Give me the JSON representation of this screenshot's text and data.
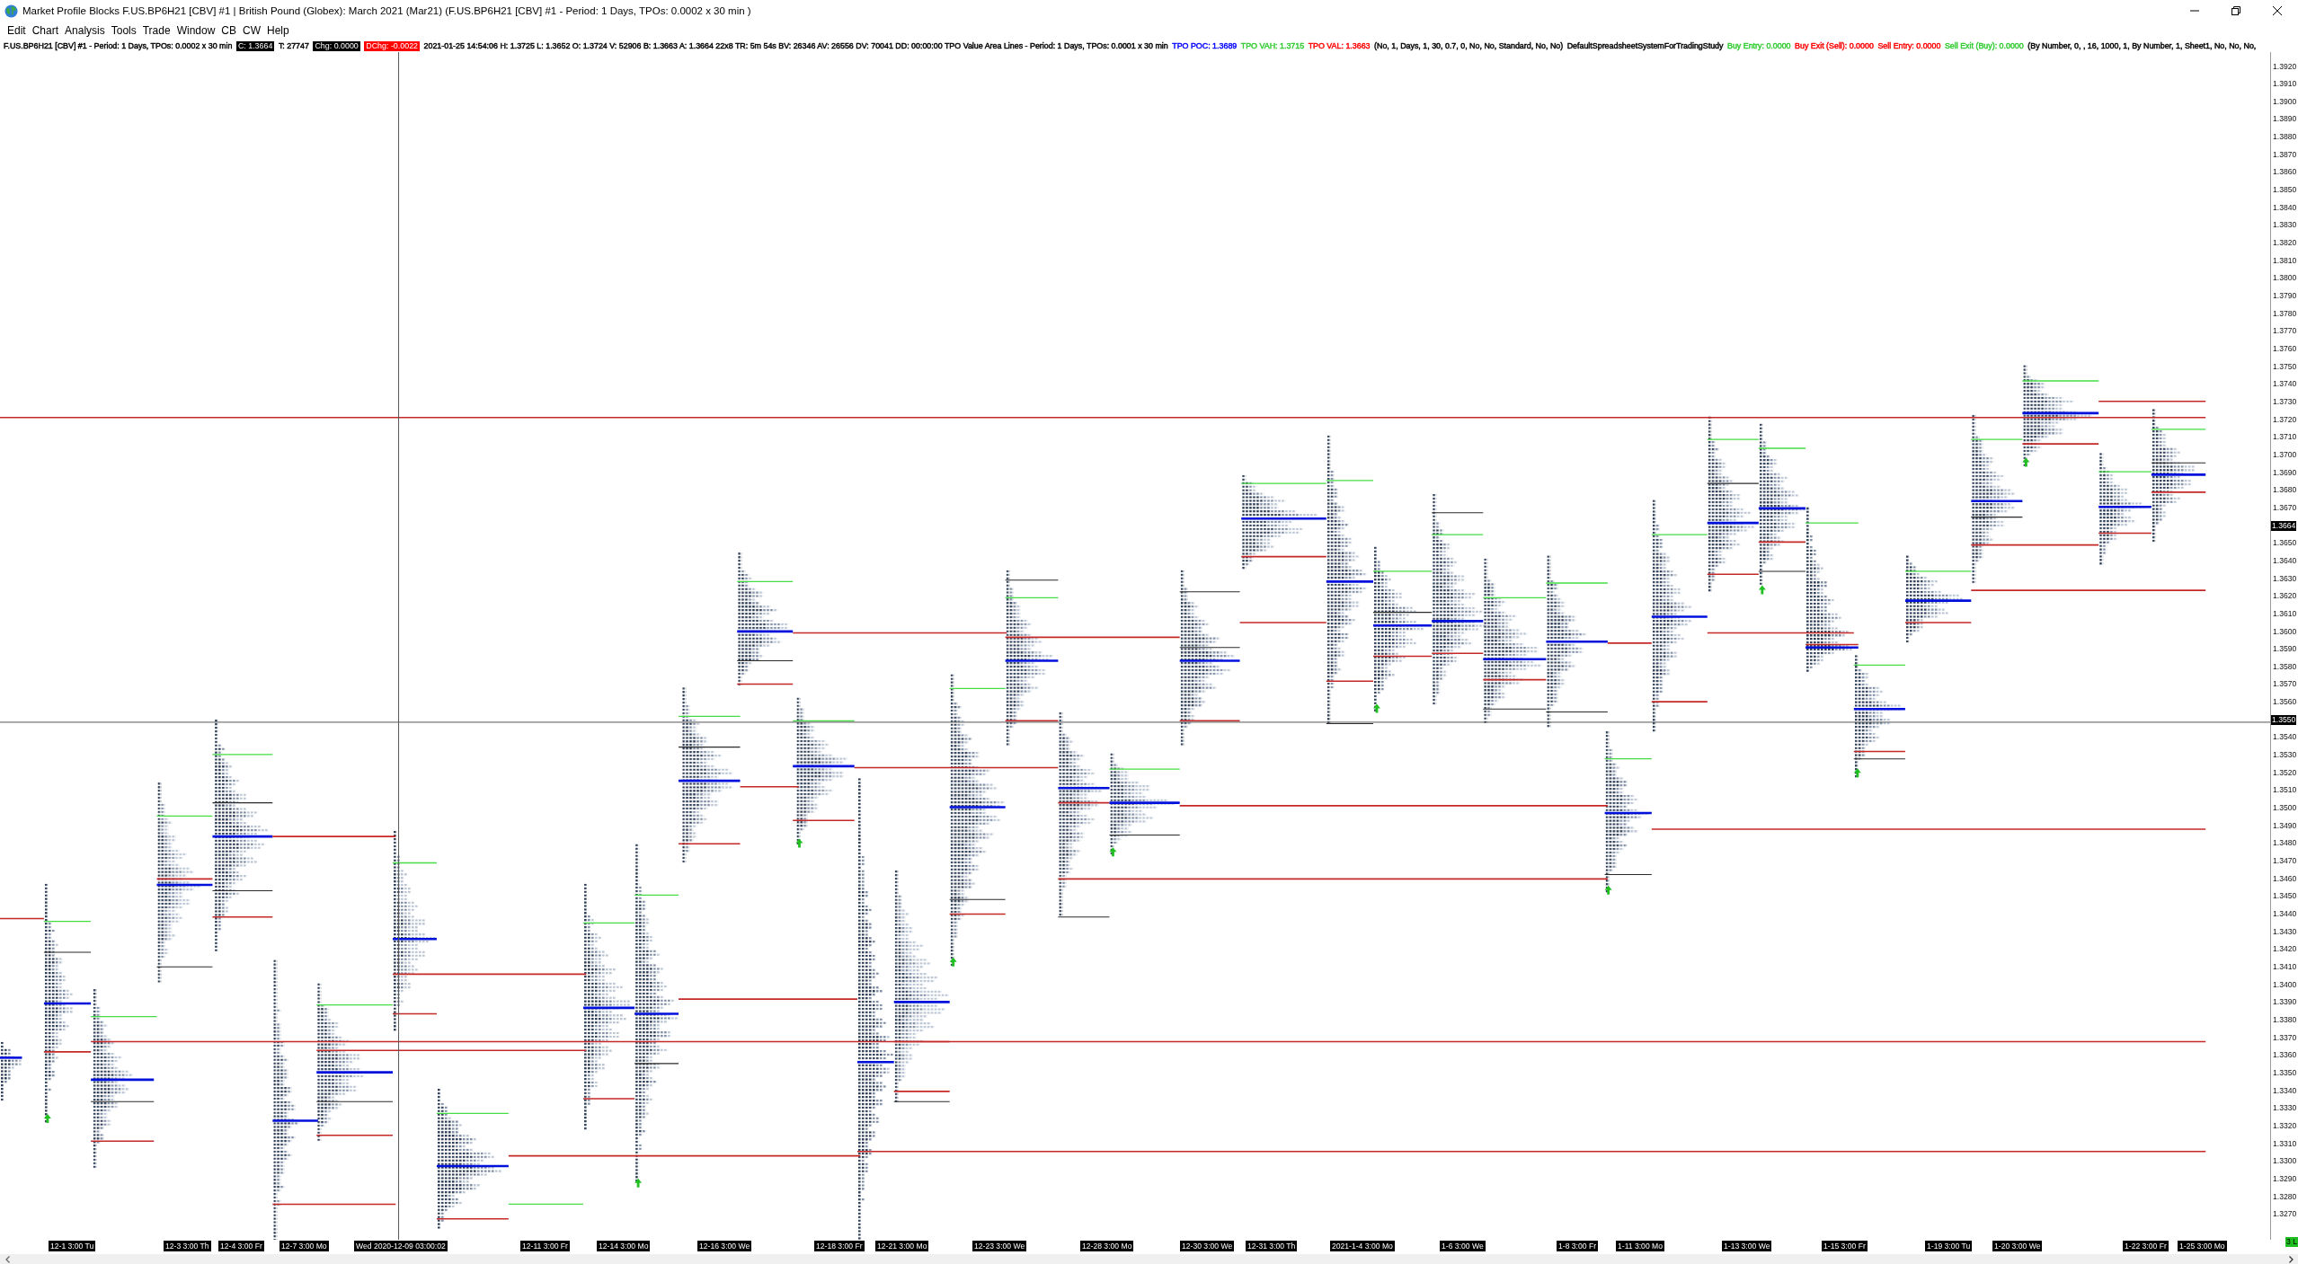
{
  "window": {
    "title": "Market Profile Blocks F.US.BP6H21 [CBV] #1 | British Pound (Globex): March 2021 (Mar21) (F.US.BP6H21 [CBV] #1 - Period: 1 Days, TPOs: 0.0002 x 30 min )"
  },
  "menu": [
    "Edit",
    "Chart",
    "Analysis",
    "Tools",
    "Trade",
    "Window",
    "CB",
    "CW",
    "Help"
  ],
  "info_line": [
    {
      "kind": "text",
      "text": "F.US.BP6H21 [CBV] #1 - Period: 1 Days, TPOs: 0.0002 x 30 min"
    },
    {
      "kind": "box",
      "text": "C: 1.3664",
      "color": "#000000"
    },
    {
      "kind": "text",
      "text": "T: 27747"
    },
    {
      "kind": "box",
      "text": "Chg: 0.0000",
      "color": "#000000"
    },
    {
      "kind": "box",
      "text": "DChg: -0.0022",
      "color": "#ff0000"
    },
    {
      "kind": "text",
      "text": "2021-01-25 14:54:06 H: 1.3725 L: 1.3652 O: 1.3724 V: 52906 B: 1.3663 A: 1.3664 22x8 TR: 5m 54s BV: 26346 AV: 26556 DV: 70041 DD: 00:00:00 TPO Value Area Lines - Period: 1 Days, TPOs: 0.0001 x 30 min"
    },
    {
      "kind": "text",
      "text": "TPO POC: 1.3689",
      "color": "#0000ff"
    },
    {
      "kind": "text",
      "text": "TPO VAH: 1.3715",
      "color": "#33cc33"
    },
    {
      "kind": "text",
      "text": "TPO VAL: 1.3663",
      "color": "#ff0000"
    },
    {
      "kind": "text",
      "text": "(No, 1, Days, 1, 30, 0.7, 0, No, No, Standard, No, No)"
    },
    {
      "kind": "text",
      "text": "DefaultSpreadsheetSystemForTradingStudy"
    },
    {
      "kind": "text",
      "text": "Buy Entry: 0.0000",
      "color": "#33cc33"
    },
    {
      "kind": "text",
      "text": "Buy Exit (Sell): 0.0000",
      "color": "#ff0000"
    },
    {
      "kind": "text",
      "text": "Sell Entry: 0.0000",
      "color": "#ff0000"
    },
    {
      "kind": "text",
      "text": "Sell Exit (Buy): 0.0000",
      "color": "#33cc33"
    },
    {
      "kind": "text",
      "text": "(By Number, 0, , 16, 1000, 1, By Number, 1, Sheet1, No, No, No,"
    }
  ],
  "chart": {
    "price_axis": {
      "labels": [
        {
          "kind": "tick",
          "text": "1.3920"
        },
        {
          "kind": "tick",
          "text": "1.3910"
        },
        {
          "kind": "tick",
          "text": "1.3900"
        },
        {
          "kind": "tick",
          "text": "1.3890"
        },
        {
          "kind": "tick",
          "text": "1.3880"
        },
        {
          "kind": "tick",
          "text": "1.3870"
        },
        {
          "kind": "tick",
          "text": "1.3860"
        },
        {
          "kind": "tick",
          "text": "1.3850"
        },
        {
          "kind": "tick",
          "text": "1.3840"
        },
        {
          "kind": "tick",
          "text": "1.3830"
        },
        {
          "kind": "tick",
          "text": "1.3820"
        },
        {
          "kind": "tick",
          "text": "1.3810"
        },
        {
          "kind": "tick",
          "text": "1.3800"
        },
        {
          "kind": "tick",
          "text": "1.3790"
        },
        {
          "kind": "tick",
          "text": "1.3780"
        },
        {
          "kind": "tick",
          "text": "1.3770"
        },
        {
          "kind": "tick",
          "text": "1.3760"
        },
        {
          "kind": "tick",
          "text": "1.3750"
        },
        {
          "kind": "tick",
          "text": "1.3740"
        },
        {
          "kind": "tick",
          "text": "1.3730"
        },
        {
          "kind": "tick",
          "text": "1.3720"
        },
        {
          "kind": "tick",
          "text": "1.3710"
        },
        {
          "kind": "tick",
          "text": "1.3700"
        },
        {
          "kind": "tick",
          "text": "1.3690"
        },
        {
          "kind": "tick",
          "text": "1.3680"
        },
        {
          "kind": "tick",
          "text": "1.3670"
        },
        {
          "kind": "marker",
          "text": "1.3664"
        },
        {
          "kind": "tick",
          "text": "1.3650"
        },
        {
          "kind": "tick",
          "text": "1.3640"
        },
        {
          "kind": "tick",
          "text": "1.3630"
        },
        {
          "kind": "tick",
          "text": "1.3620"
        },
        {
          "kind": "tick",
          "text": "1.3610"
        },
        {
          "kind": "tick",
          "text": "1.3600"
        },
        {
          "kind": "tick",
          "text": "1.3590"
        },
        {
          "kind": "tick",
          "text": "1.3580"
        },
        {
          "kind": "tick",
          "text": "1.3570"
        },
        {
          "kind": "tick",
          "text": "1.3560"
        },
        {
          "kind": "marker",
          "text": "1.3550"
        },
        {
          "kind": "tick",
          "text": "1.3540"
        },
        {
          "kind": "tick",
          "text": "1.3530"
        },
        {
          "kind": "tick",
          "text": "1.3520"
        },
        {
          "kind": "tick",
          "text": "1.3510"
        },
        {
          "kind": "tick",
          "text": "1.3500"
        },
        {
          "kind": "tick",
          "text": "1.3490"
        },
        {
          "kind": "tick",
          "text": "1.3480"
        },
        {
          "kind": "tick",
          "text": "1.3470"
        },
        {
          "kind": "tick",
          "text": "1.3460"
        },
        {
          "kind": "tick",
          "text": "1.3450"
        },
        {
          "kind": "tick",
          "text": "1.3440"
        },
        {
          "kind": "tick",
          "text": "1.3430"
        },
        {
          "kind": "tick",
          "text": "1.3420"
        },
        {
          "kind": "tick",
          "text": "1.3410"
        },
        {
          "kind": "tick",
          "text": "1.3400"
        },
        {
          "kind": "tick",
          "text": "1.3390"
        },
        {
          "kind": "tick",
          "text": "1.3380"
        },
        {
          "kind": "tick",
          "text": "1.3370"
        },
        {
          "kind": "tick",
          "text": "1.3360"
        },
        {
          "kind": "tick",
          "text": "1.3350"
        },
        {
          "kind": "tick",
          "text": "1.3340"
        },
        {
          "kind": "tick",
          "text": "1.3330"
        },
        {
          "kind": "tick",
          "text": "1.3320"
        },
        {
          "kind": "tick",
          "text": "1.3310"
        },
        {
          "kind": "tick",
          "text": "1.3300"
        },
        {
          "kind": "tick",
          "text": "1.3290"
        },
        {
          "kind": "tick",
          "text": "1.3280"
        },
        {
          "kind": "tick",
          "text": "1.3270"
        }
      ]
    },
    "time_axis": {
      "labels": [
        "12-1 3:00 Tu",
        "12-3 3:00 Th",
        "12-4 3:00 Fr",
        "12-7 3:00 Mo",
        "Wed 2020-12-09 03:00:02",
        "12-11 3:00 Fr",
        "12-14 3:00 Mo",
        "12-16 3:00 We",
        "12-18 3:00 Fr",
        "12-21 3:00 Mo",
        "12-23 3:00 We",
        "12-28 3:00 Mo",
        "12-30 3:00 We",
        "12-31 3:00 Th",
        "2021-1-4 3:00 Mo",
        "1-6 3:00 We",
        "1-8 3:00 Fr",
        "1-11 3:00 Mo",
        "1-13 3:00 We",
        "1-15 3:00 Fr",
        "1-19 3:00 Tu",
        "1-20 3:00 We",
        "1-22 3:00 Fr",
        "1-25 3:00 Mo"
      ]
    }
  },
  "status_badge": {
    "text": "3 L"
  }
}
